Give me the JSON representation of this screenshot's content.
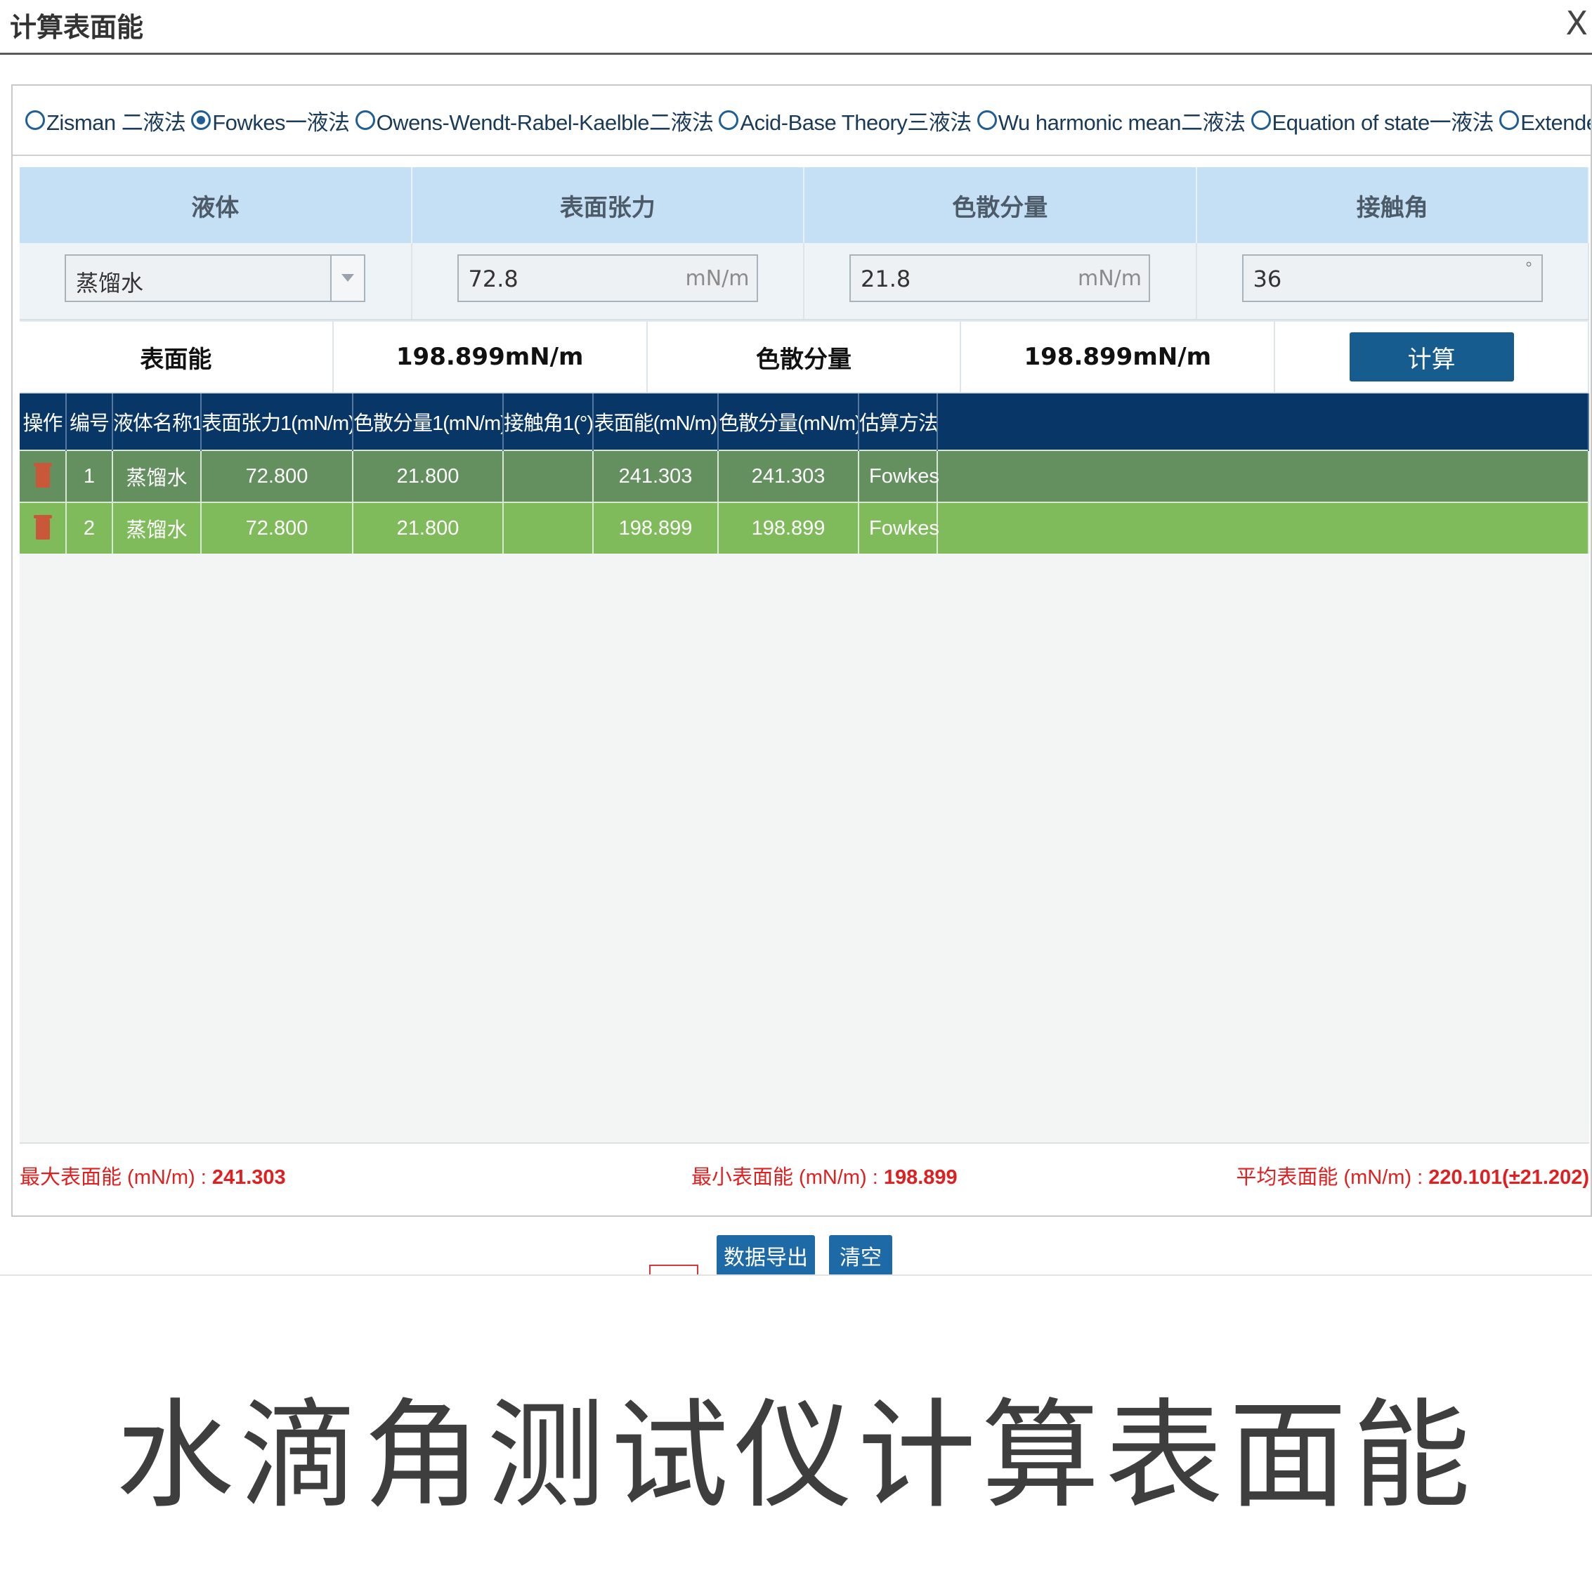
{
  "window": {
    "title": "计算表面能",
    "close_symbol": "X"
  },
  "methods": [
    {
      "label": "Zisman 二液法",
      "checked": false
    },
    {
      "label": "Fowkes一液法",
      "checked": true
    },
    {
      "label": "Owens-Wendt-Rabel-Kaelble二液法",
      "checked": false
    },
    {
      "label": "Acid-Base Theory三液法",
      "checked": false
    },
    {
      "label": "Wu harmonic mean二液法",
      "checked": false
    },
    {
      "label": "Equation of state一液法",
      "checked": false
    },
    {
      "label": "Extended Fowkes三液法",
      "checked": false
    }
  ],
  "input_headers": {
    "liquid": "液体",
    "surface_tension": "表面张力",
    "dispersive": "色散分量",
    "contact_angle": "接触角"
  },
  "inputs": {
    "liquid_value": "蒸馏水",
    "surface_tension_value": "72.8",
    "surface_tension_unit": "mN/m",
    "dispersive_value": "21.8",
    "dispersive_unit": "mN/m",
    "contact_angle_value": "36",
    "contact_angle_unit": "°"
  },
  "results": {
    "surface_energy_label": "表面能",
    "surface_energy_value": "198.899mN/m",
    "dispersive_label": "色散分量",
    "dispersive_value": "198.899mN/m",
    "calc_button": "计算"
  },
  "table": {
    "headers": [
      "操作",
      "编号",
      "液体名称1",
      "表面张力1(mN/m)",
      "色散分量1(mN/m)",
      "接触角1(°)",
      "表面能(mN/m)",
      "色散分量(mN/m)",
      "估算方法"
    ],
    "rows": [
      [
        "",
        "1",
        "蒸馏水",
        "72.800",
        "21.800",
        "",
        "241.303",
        "241.303",
        "Fowkes"
      ],
      [
        "",
        "2",
        "蒸馏水",
        "72.800",
        "21.800",
        "",
        "198.899",
        "198.899",
        "Fowkes"
      ]
    ]
  },
  "stats": {
    "max_label": "最大表面能 (mN/m) : ",
    "max_value": "241.303",
    "min_label": "最小表面能 (mN/m) : ",
    "min_value": "198.899",
    "avg_label": "平均表面能 (mN/m) : ",
    "avg_value": "220.101(±21.202)"
  },
  "buttons": {
    "export": "数据导出",
    "clear": "清空"
  },
  "caption": "水滴角测试仪计算表面能",
  "colors": {
    "header_blue": "#083666",
    "row1_green": "#649060",
    "row2_green": "#7fbb5a",
    "button_blue": "#165c8e",
    "stat_red": "#e02020"
  },
  "icons": {
    "row_action": "trash-icon",
    "dropdown": "chevron-down-icon"
  }
}
